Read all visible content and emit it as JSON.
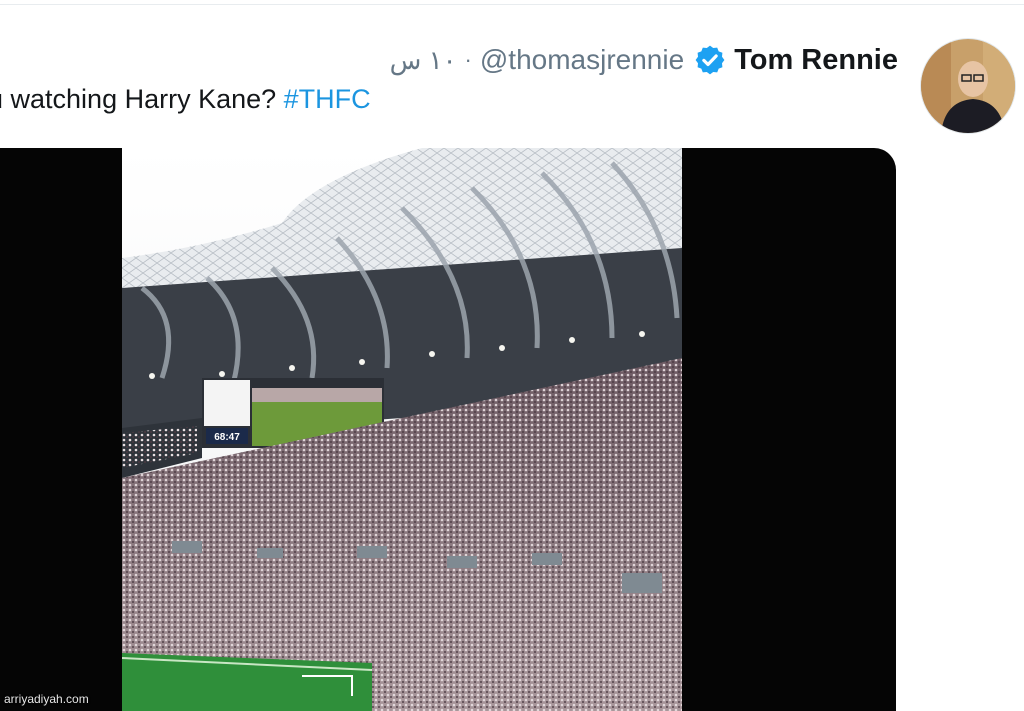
{
  "tweet": {
    "display_name": "Tom Rennie",
    "handle": "@thomasjrennie",
    "separator": "·",
    "time": "١٠ س",
    "text_main": "u watching Harry Kane? ",
    "hashtag": "#THFC",
    "verified_icon": "verified-badge-icon"
  },
  "media": {
    "scoreboard_clock": "68:47"
  },
  "watermark": "arriyadiyah.com",
  "colors": {
    "link": "#1b95e0",
    "verified": "#1da1f2",
    "text": "#14171a",
    "secondary": "#657786",
    "media_bg": "#050505"
  }
}
